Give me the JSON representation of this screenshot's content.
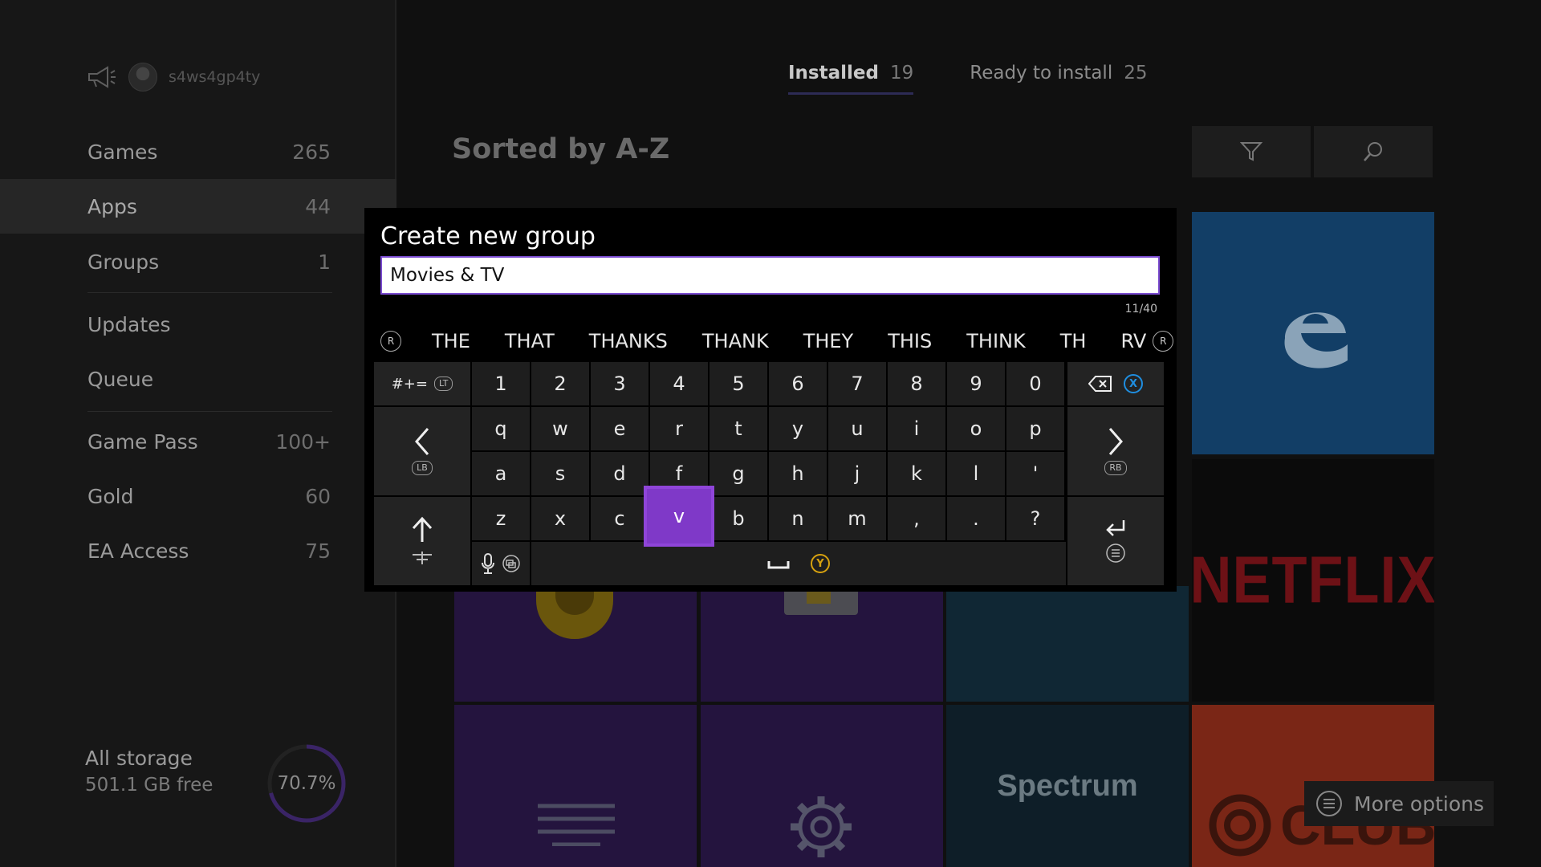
{
  "profile": {
    "gamertag": "s4ws4gp4ty"
  },
  "sidebar": {
    "items": [
      {
        "label": "Games",
        "count": "265"
      },
      {
        "label": "Apps",
        "count": "44"
      },
      {
        "label": "Groups",
        "count": "1"
      },
      {
        "label": "Updates",
        "count": ""
      },
      {
        "label": "Queue",
        "count": ""
      },
      {
        "label": "Game Pass",
        "count": "100+"
      },
      {
        "label": "Gold",
        "count": "60"
      },
      {
        "label": "EA Access",
        "count": "75"
      }
    ],
    "active_index": 1
  },
  "storage": {
    "label": "All storage",
    "free": "501.1 GB free",
    "percent_text": "70.7%",
    "percent": 70.7
  },
  "tabs": [
    {
      "label": "Installed",
      "count": "19",
      "active": true
    },
    {
      "label": "Ready to install",
      "count": "25",
      "active": false
    }
  ],
  "main": {
    "sort_title": "Sorted by A-Z"
  },
  "tiles": {
    "netflix": "NETFLIX",
    "spectrum": "Spectrum",
    "club": "CLUB"
  },
  "more_options": {
    "label": "More options"
  },
  "dialog": {
    "title": "Create new group",
    "input_value": "Movies & TV",
    "char_count": "11/40",
    "suggestions": [
      "THE",
      "THAT",
      "THANKS",
      "THANK",
      "THEY",
      "THIS",
      "THINK",
      "TH",
      "RV"
    ]
  },
  "keyboard": {
    "symbols_label": "#+=",
    "row_numbers": [
      "1",
      "2",
      "3",
      "4",
      "5",
      "6",
      "7",
      "8",
      "9",
      "0"
    ],
    "row_1": [
      "q",
      "w",
      "e",
      "r",
      "t",
      "y",
      "u",
      "i",
      "o",
      "p"
    ],
    "row_2": [
      "a",
      "s",
      "d",
      "f",
      "g",
      "h",
      "j",
      "k",
      "l",
      "'"
    ],
    "row_3": [
      "z",
      "x",
      "c",
      "v",
      "b",
      "n",
      "m",
      ",",
      ".",
      "?"
    ],
    "highlighted_key": "v",
    "badges": {
      "lt": "LT",
      "lb": "LB",
      "rb": "RB",
      "x": "X",
      "y": "Y"
    }
  },
  "colors": {
    "accent": "#7f39c8",
    "background": "#101010",
    "edge_tile": "#123e66",
    "y_button": "#d7a20f",
    "x_button": "#1f8ee0"
  }
}
